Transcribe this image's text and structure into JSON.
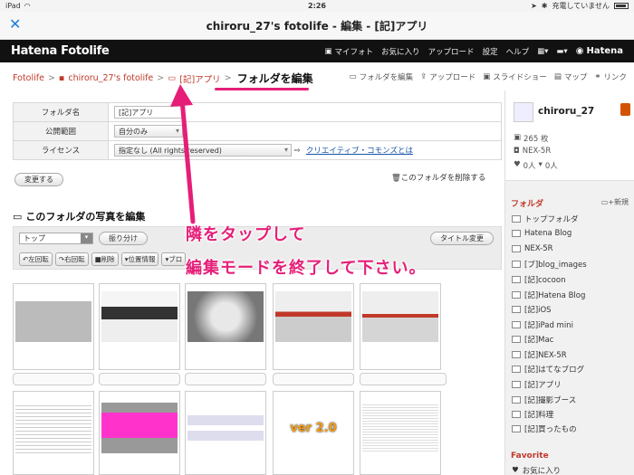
{
  "status": {
    "device": "iPad",
    "time": "2:26",
    "charge": "充電していません"
  },
  "window": {
    "title": "chiroru_27's fotolife - 編集 - [記]アプリ",
    "close_label": "✕"
  },
  "header": {
    "logo": "Hatena Fotolife",
    "nav": [
      "マイフォト",
      "お気に入り",
      "アップロード",
      "設定",
      "ヘルプ"
    ],
    "brand": "Hatena"
  },
  "breadcrumb": {
    "items": [
      "Fotolife",
      "chiroru_27's fotolife",
      "[記]アプリ"
    ],
    "current": "フォルダを編集",
    "separator": ">"
  },
  "toolbar": [
    "フォルダを編集",
    "アップロード",
    "スライドショー",
    "マップ",
    "リンク"
  ],
  "folder_settings": {
    "rows": [
      {
        "label": "フォルダ名",
        "value": "[記]アプリ"
      },
      {
        "label": "公開範囲",
        "value": "自分のみ"
      },
      {
        "label": "ライセンス",
        "value": "指定なし (All rights reserved)",
        "link": "クリエイティブ・コモンズとは"
      }
    ],
    "save_label": "変更する",
    "delete_label": "このフォルダを削除する"
  },
  "photo_edit": {
    "title": "このフォルダの写真を編集",
    "target_folder": "トップ",
    "sort_label": "振り分け",
    "title_change_label": "タイトル変更",
    "actions": [
      "左回転",
      "右回転",
      "削除",
      "位置情報",
      "ブロ"
    ]
  },
  "profile": {
    "name": "chiroru_27",
    "photos": "265 枚",
    "camera": "NEX-5R",
    "likes_given": "0人",
    "likes_received": "0人"
  },
  "sidebar": {
    "folder_heading": "フォルダ",
    "new_label": "新規",
    "folders": [
      "トップフォルダ",
      "Hatena Blog",
      "NEX-5R",
      "[ブ]blog_images",
      "[記]cocoon",
      "[記]Hatena Blog",
      "[記]iOS",
      "[記]iPad mini",
      "[記]Mac",
      "[記]NEX-5R",
      "[記]はてなブログ",
      "[記]アプリ",
      "[記]撮影ブース",
      "[記]料理",
      "[記]買ったもの"
    ],
    "favorite_heading": "Favorite",
    "favorite_item": "お気に入り"
  },
  "annotation": {
    "line1": "隣をタップして",
    "line2": "編集モードを終了して下さい。"
  },
  "thumb_badge": "ver 2.0",
  "colors": {
    "accent": "#e61e78",
    "link": "#c0392b",
    "header_bg": "#111111"
  }
}
